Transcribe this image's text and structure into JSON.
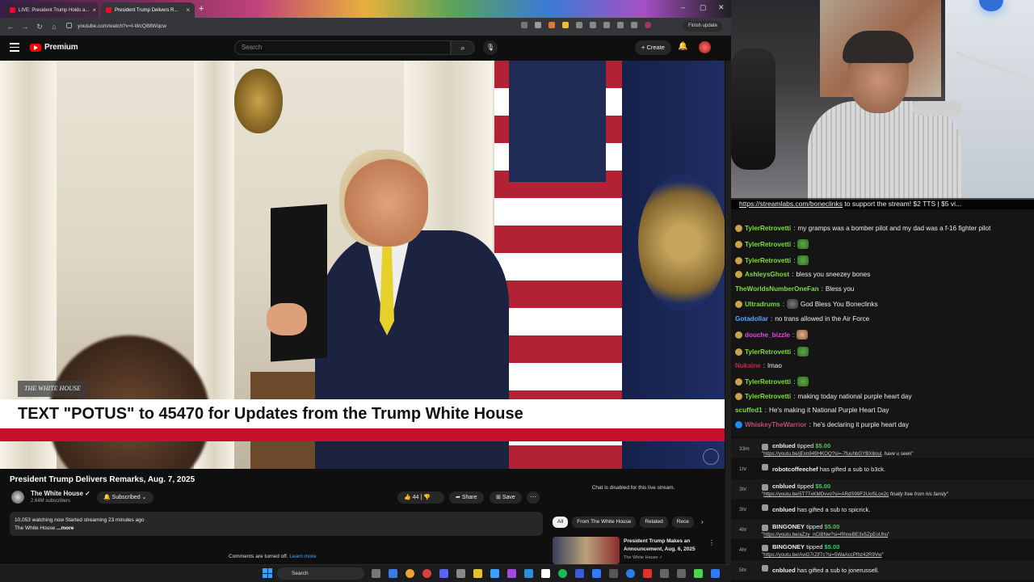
{
  "browser": {
    "tabs": [
      {
        "label": "LIVE: President Trump Holds a..."
      },
      {
        "label": "President Trump Delivers R..."
      }
    ],
    "url": "youtube.com/watch?v=t-WcQ88Wqcw",
    "finish_update_label": "Finish update"
  },
  "youtube": {
    "brand": "Premium",
    "search_placeholder": "Search",
    "create_label": "+ Create",
    "video": {
      "badge_text": "THE WHITE HOUSE",
      "lower_third": "TEXT \"POTUS\" to 45470 for Updates from the Trump White House"
    },
    "title": "President Trump Delivers Remarks, Aug. 7, 2025",
    "channel": {
      "name": "The White House ✓",
      "subs": "2.64M subscribers",
      "subscribed_label": "Subscribed ⌄"
    },
    "actions": {
      "like": "👍 44  |  👎",
      "share": "Share",
      "save": "Save",
      "more": "⋯"
    },
    "description": {
      "line1": "10,053 watching now  Started streaming 23 minutes ago",
      "line2": "The White House",
      "more": "...more"
    },
    "comments_off": "Comments are turned off.",
    "learn_more": "Learn more",
    "chat_disabled": "Chat is disabled for this live stream.",
    "chips": [
      "All",
      "From The White House",
      "Related",
      "Rece"
    ],
    "recommendation": {
      "title": "President Trump Makes an Announcement, Aug. 6, 2025",
      "channel": "The White House ✓"
    }
  },
  "taskbar": {
    "search_label": "Search"
  },
  "stream": {
    "overlay_prefix": "https://streamlabs.com/boneclinks",
    "overlay_rest": " to support the stream! $2 TTS | $5 vi..."
  },
  "chat": [
    {
      "user": "TylerRetrovetti",
      "color": "#7cdc3a",
      "text": "my gramps was a bomber pilot and my dad was a f-16 fighter pilot",
      "emote": "",
      "badge": true
    },
    {
      "user": "TylerRetrovetti",
      "color": "#7cdc3a",
      "text": "",
      "emote": "pepe",
      "badge": true
    },
    {
      "user": "TylerRetrovetti",
      "color": "#7cdc3a",
      "text": "",
      "emote": "pepe",
      "badge": true
    },
    {
      "user": "AshleysGhost",
      "color": "#7cdc3a",
      "text": "bless you sneezey bones",
      "emote": "",
      "badge": true
    },
    {
      "user": "TheWorldsNumberOneFan",
      "color": "#7cdc3a",
      "text": "Bless you",
      "emote": "",
      "badge": false
    },
    {
      "user": "Ultradrums",
      "color": "#7cdc3a",
      "text": "God Bless You Boneclinks",
      "emote": "dark",
      "badge": true
    },
    {
      "user": "Gotadollar",
      "color": "#5aa6ff",
      "text": "no trans allowed in the Air Force",
      "emote": "",
      "badge": false
    },
    {
      "user": "douche_bizzle",
      "color": "#e14be0",
      "text": "",
      "emote": "face",
      "badge": true
    },
    {
      "user": "TylerRetrovetti",
      "color": "#7cdc3a",
      "text": "",
      "emote": "pepe",
      "badge": true
    },
    {
      "user": "Nukaine",
      "color": "#c22b4a",
      "text": "lmao",
      "emote": "",
      "badge": false
    },
    {
      "user": "TylerRetrovetti",
      "color": "#7cdc3a",
      "text": "",
      "emote": "pepe",
      "badge": true
    },
    {
      "user": "TylerRetrovetti",
      "color": "#7cdc3a",
      "text": "making today national purple heart day",
      "emote": "",
      "badge": true
    },
    {
      "user": "scuffed1",
      "color": "#7cdc3a",
      "text": "He's making it National Purple Heart Day",
      "emote": "",
      "badge": false
    },
    {
      "user": "WhiskeyTheWarrior",
      "color": "#c24a7a",
      "text": "he's declaring it purple heart day",
      "emote": "",
      "badge": true
    }
  ],
  "events": [
    {
      "time": "33m",
      "user": "cnblued",
      "action": "tipped",
      "amount": "$5.00",
      "link": "https://youtu.be/jExn949HKOQ?si=-7fuuhbGYBX8oul",
      "note": ", have u seen"
    },
    {
      "time": "1hr",
      "user": "robotcoffeechef",
      "action": "has gifted a sub to b3ck.",
      "amount": "",
      "link": "",
      "note": ""
    },
    {
      "time": "3hr",
      "user": "cnblued",
      "action": "tipped",
      "amount": "$5.00",
      "link": "https://youtu.be/5T77xKMDvvo?si=ARdS99F2UoSLox2c",
      "note": " finally free from his family"
    },
    {
      "time": "3hr",
      "user": "cnblued",
      "action": "has gifted a sub to spicrick.",
      "amount": "",
      "link": "",
      "note": ""
    },
    {
      "time": "4hr",
      "user": "BINGONEY",
      "action": "tipped",
      "amount": "$5.00",
      "link": "https://youtu.be/aZzy_nCiBNw?si=RhneBE3x5ZpEoUhu",
      "note": ""
    },
    {
      "time": "4hr",
      "user": "BINGONEY",
      "action": "tipped",
      "amount": "$5.00",
      "link": "https://youtu.be/AviG7rZif7c?si=5WaAccPfhz42R9Vw",
      "note": ""
    },
    {
      "time": "5hr",
      "user": "cnblued",
      "action": "has gifted a sub to jonerussell.",
      "amount": "",
      "link": "",
      "note": ""
    }
  ]
}
